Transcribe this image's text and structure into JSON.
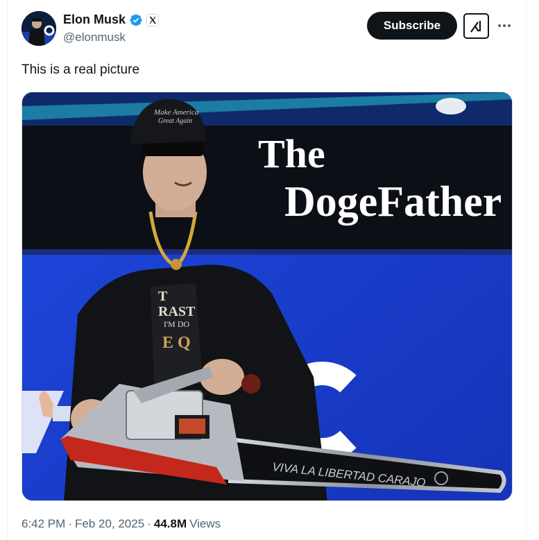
{
  "author": {
    "name": "Elon Musk",
    "handle": "@elonmusk"
  },
  "header": {
    "subscribe_label": "Subscribe"
  },
  "tweet": {
    "text": "This is a real picture"
  },
  "media": {
    "title_line1": "The",
    "title_line2": "DogeFather",
    "saw_bar_text": "VIVA LA LIBERTAD CARAJO"
  },
  "meta": {
    "time": "6:42 PM",
    "separator1": "·",
    "date": "Feb 20, 2025",
    "separator2": "·",
    "views_count": "44.8M",
    "views_label": "Views"
  },
  "colors": {
    "accent": "#1d9bf0",
    "text_primary": "#0f1419",
    "text_secondary": "#536471",
    "stage_blue": "#1a3fd0"
  },
  "icons": {
    "verified": "verified-badge-icon",
    "affiliate": "x-logo-icon",
    "grok": "grok-icon",
    "more": "more-dots-icon"
  }
}
